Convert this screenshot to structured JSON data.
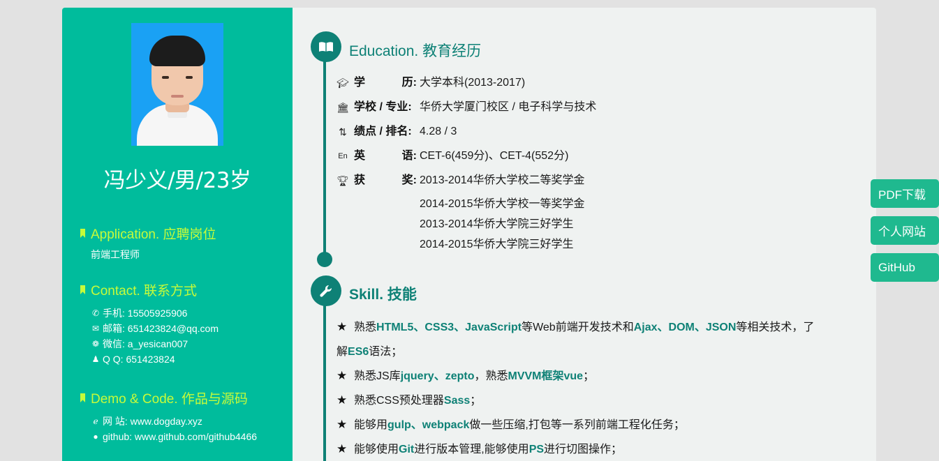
{
  "profile": {
    "name": "冯少义/男/23岁"
  },
  "application": {
    "title": "Application. 应聘岗位",
    "position": "前端工程师"
  },
  "contact": {
    "title": "Contact. 联系方式",
    "items": [
      {
        "icon": "phone-icon",
        "text": "手机: 15505925906"
      },
      {
        "icon": "mail-icon",
        "text": "邮箱: 651423824@qq.com"
      },
      {
        "icon": "wechat-icon",
        "text": "微信: a_yesican007"
      },
      {
        "icon": "qq-icon",
        "text": "Q  Q: 651423824"
      }
    ]
  },
  "demo": {
    "title": "Demo & Code. 作品与源码",
    "items": [
      {
        "icon": "ie-icon",
        "text": "网    站: www.dogday.xyz"
      },
      {
        "icon": "github-icon",
        "text": "github: www.github.com/github4466"
      }
    ]
  },
  "education": {
    "title": "Education. 教育经历",
    "degree": {
      "label_a": "学",
      "label_b": "历:",
      "value": "大学本科(2013-2017)"
    },
    "school": {
      "label": "学校 / 专业:",
      "value": "华侨大学厦门校区 / 电子科学与技术"
    },
    "gpa": {
      "label": "绩点 / 排名:",
      "value": "4.28 / 3"
    },
    "language": {
      "label_a": "英",
      "label_b": "语:",
      "value": "CET-6(459分)、CET-4(552分)"
    },
    "awards": {
      "label_a": "获",
      "label_b": "奖:",
      "items": [
        "2013-2014华侨大学校二等奖学金",
        "2014-2015华侨大学校一等奖学金",
        "2013-2014华侨大学院三好学生",
        "2014-2015华侨大学院三好学生"
      ]
    }
  },
  "skill": {
    "title": "Skill. 技能",
    "s1": {
      "a": "熟悉",
      "b": "HTML5、CSS3、JavaScript",
      "c": "等Web前端开发技术和",
      "d": "Ajax、DOM、JSON",
      "e": "等相关技术，了",
      "f": "解",
      "g": "ES6",
      "h": "语法；"
    },
    "s2": {
      "a": "熟悉JS库",
      "b": "jquery、zepto",
      "c": "，熟悉",
      "d": "MVVM框架vue",
      "e": "；"
    },
    "s3": {
      "a": "熟悉CSS预处理器",
      "b": "Sass",
      "c": "；"
    },
    "s4": {
      "a": "能够用",
      "b": "gulp、webpack",
      "c": "做一些压缩,打包等一系列前端工程化任务；"
    },
    "s5": {
      "a": "能够使用",
      "b": "Git",
      "c": "进行版本管理,能够使用",
      "d": "PS",
      "e": "进行切图操作；"
    }
  },
  "floating": {
    "pdf": "PDF下载",
    "site": "个人网站",
    "github": "GitHub"
  },
  "colors": {
    "sidebar": "#00bc9c",
    "accent": "#0e8176",
    "highlight": "#c6fb3a",
    "button": "#1fb98f"
  }
}
